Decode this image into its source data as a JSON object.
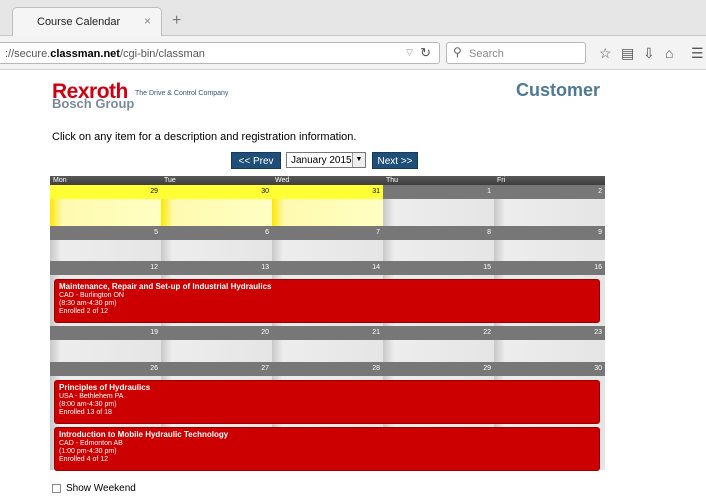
{
  "browser": {
    "tab_title": "Course Calendar",
    "tab_close": "×",
    "new_tab": "+",
    "url_prefix": "://secure.",
    "url_domain": "classman.net",
    "url_path": "/cgi-bin/classman",
    "search_placeholder": "Search"
  },
  "header": {
    "logo_main": "Rexroth",
    "logo_sub": "Bosch Group",
    "tagline": "The Drive & Control Company",
    "page_heading": "Customer"
  },
  "instructions": "Click on any item for a description and registration information.",
  "nav": {
    "prev_label": "<< Prev",
    "month_value": "January 2015",
    "next_label": "Next >>"
  },
  "calendar": {
    "day_headers": [
      "Mon",
      "Tue",
      "Wed",
      "Thu",
      "Fri"
    ],
    "weeks": [
      {
        "dates": [
          "29",
          "30",
          "31",
          "1",
          "2"
        ]
      },
      {
        "dates": [
          "5",
          "6",
          "7",
          "8",
          "9"
        ]
      },
      {
        "dates": [
          "12",
          "13",
          "14",
          "15",
          "16"
        ]
      },
      {
        "dates": [
          "19",
          "20",
          "21",
          "22",
          "23"
        ]
      },
      {
        "dates": [
          "26",
          "27",
          "28",
          "29",
          "30"
        ]
      }
    ],
    "events": [
      {
        "title": "Maintenance, Repair and Set-up of Industrial Hydraulics",
        "location": "CAD - Burlington ON",
        "time": "(8:30 am-4:30 pm)",
        "enrolled": "Enrolled 2 of 12"
      },
      {
        "title": "Principles of Hydraulics",
        "location": "USA - Bethlehem PA",
        "time": "(8:00 am-4:30 pm)",
        "enrolled": "Enrolled 13 of 18"
      },
      {
        "title": "Introduction to Mobile Hydraulic Technology",
        "location": "CAD - Edmonton AB",
        "time": "(1:00 pm-4:30 pm)",
        "enrolled": "Enrolled 4 of 12"
      }
    ]
  },
  "show_weekend_label": "Show Weekend"
}
